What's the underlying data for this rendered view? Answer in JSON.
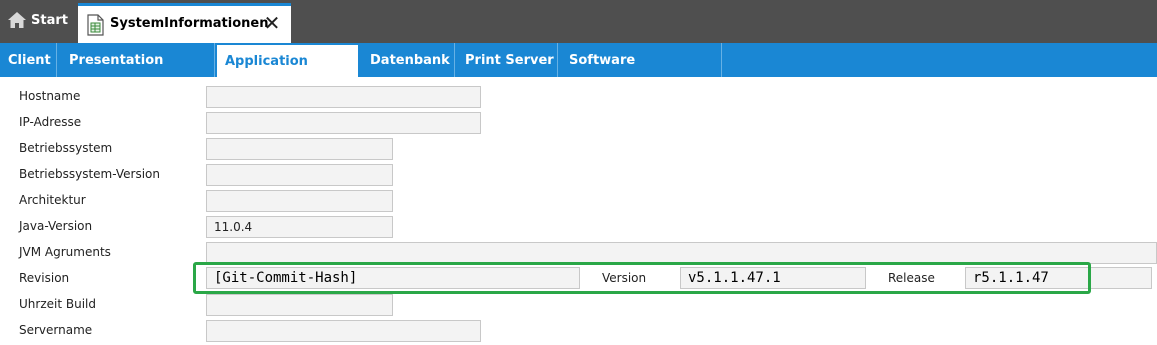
{
  "tabs": {
    "start_label": "Start",
    "current_label": "SystemInformationen",
    "close_glyph": "✕"
  },
  "subtabs": [
    "Client",
    "Presentation Server",
    "Application Server",
    "Datenbank",
    "Print Server",
    "Software Schutzcode"
  ],
  "active_subtab": "Application Server",
  "form": {
    "hostname_label": "Hostname",
    "hostname_value": "",
    "ip_label": "IP-Adresse",
    "ip_value": "",
    "os_label": "Betriebssystem",
    "os_value": "",
    "os_version_label": "Betriebssystem-Version",
    "os_version_value": "",
    "arch_label": "Architektur",
    "arch_value": "",
    "java_label": "Java-Version",
    "java_value": "11.0.4",
    "jvm_label": "JVM Agruments",
    "jvm_value": "",
    "revision_label": "Revision",
    "revision_value": "[Git-Commit-Hash]",
    "version_label": "Version",
    "version_value": "v5.1.1.47.1",
    "release_label": "Release",
    "release_value": "r5.1.1.47",
    "build_time_label": "Uhrzeit Build",
    "build_time_value": "",
    "servername_label": "Servername",
    "servername_value": ""
  },
  "colors": {
    "topbar": "#4f4f4f",
    "accent": "#1a87d4",
    "highlight": "#2aa747"
  },
  "icons": {
    "start": "home-icon",
    "document": "document-icon",
    "close": "close-icon"
  }
}
